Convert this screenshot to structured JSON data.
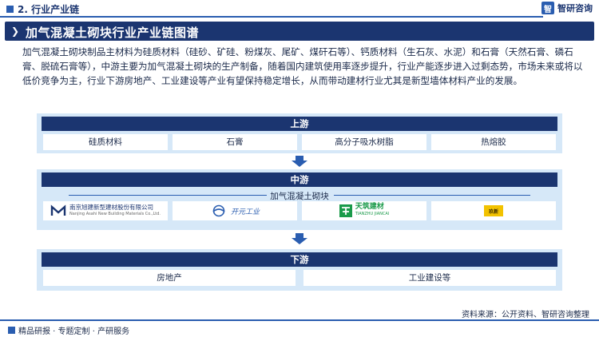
{
  "header": {
    "section": "2. 行业产业链",
    "brand": "智研咨询"
  },
  "title": "加气混凝土砌块行业产业链图谱",
  "intro": "加气混凝土砌块制品主材料为硅质材料（硅砂、矿硅、粉煤灰、尾矿、煤矸石等）、钙质材料（生石灰、水泥）和石膏（天然石膏、磷石膏、脱硫石膏等），中游主要为加气混凝土砌块的生产制备，随着国内建筑使用率逐步提升，行业产能逐步进入过剩态势，市场未来或将以低价竞争为主，行业下游房地产、工业建设等产业有望保持稳定增长，从而带动建材行业尤其是新型墙体材料产业的发展。",
  "upstream": {
    "label": "上游",
    "items": [
      "硅质材料",
      "石膏",
      "高分子吸水树脂",
      "热熔胶"
    ]
  },
  "midstream": {
    "label": "中游",
    "subtitle": "加气混凝土砌块",
    "companies": [
      {
        "name": "南京旭建新型建材股份有限公司",
        "name_en": "Nanjing Asahi New Building Materials Co.,Ltd.",
        "mark": "NASAHI"
      },
      {
        "name": "开元工业"
      },
      {
        "name": "天筑建材",
        "name_en": "TIANZHU JIANCAI"
      },
      {
        "name": "玖新"
      }
    ]
  },
  "downstream": {
    "label": "下游",
    "items": [
      "房地产",
      "工业建设等"
    ]
  },
  "footer": {
    "left": "精品研报 · 专题定制 · 产研服务",
    "source": "资料来源：公开资料、智研咨询整理"
  },
  "colors": {
    "navy": "#1b3570",
    "accent": "#2a5db0",
    "panel": "#d6e8f8",
    "logo_green": "#1a9a4a",
    "logo_yellow": "#f2c200"
  }
}
